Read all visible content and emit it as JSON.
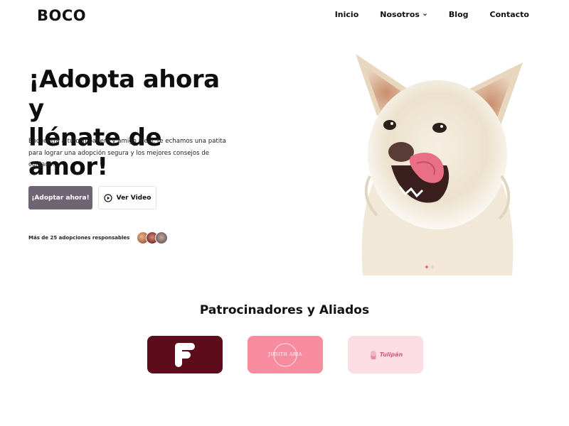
{
  "header": {
    "logo": "BOCO",
    "nav": [
      {
        "label": "Inicio"
      },
      {
        "label": "Nosotros",
        "has_dropdown": true
      },
      {
        "label": "Blog"
      },
      {
        "label": "Contacto"
      }
    ]
  },
  "hero": {
    "title_line1": "¡Adopta ahora y",
    "title_line2": "llénate de amor!",
    "description": "Encuentra a tu compañero y amigo ideal, te echamos una patita para lograr una adopción segura y los mejores consejos de cuidado.",
    "primary_button": "¡Adoptar ahora!",
    "video_button": "Ver Video",
    "social_proof": "Más de 25 adopciones responsables",
    "carousel": {
      "slides": 2,
      "active": 0
    }
  },
  "sponsors": {
    "title": "Patrocinadores y Aliados",
    "items": [
      {
        "logo_text": ""
      },
      {
        "logo_text": "JUDITH ARIA"
      },
      {
        "logo_text": "Tulipán"
      }
    ]
  },
  "colors": {
    "primary_button": "#6f6474",
    "accent_pink": "#ee6d8b",
    "sponsor1": "#5c0c1a",
    "sponsor2": "#f98b9f",
    "sponsor3": "#fcdde3"
  }
}
